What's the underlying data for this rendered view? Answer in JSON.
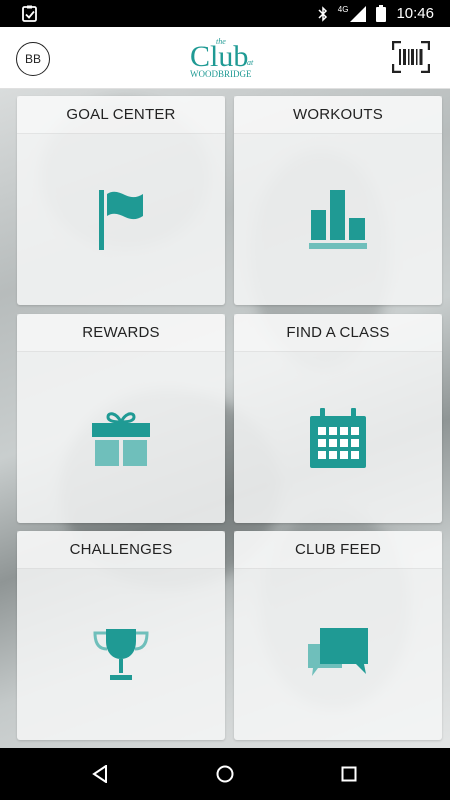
{
  "status_bar": {
    "time": "10:46",
    "network_type": "4G",
    "icons": [
      "checkbox-notification-icon",
      "bluetooth-icon",
      "signal-icon",
      "battery-icon"
    ]
  },
  "header": {
    "avatar_initials": "BB",
    "logo": {
      "line1": "the",
      "line2": "Club",
      "line3": "at",
      "line4": "WOODBRIDGE"
    },
    "barcode_icon": "barcode-scan-icon"
  },
  "tiles": [
    {
      "label": "GOAL CENTER",
      "icon": "flag-icon"
    },
    {
      "label": "WORKOUTS",
      "icon": "bar-chart-icon"
    },
    {
      "label": "REWARDS",
      "icon": "gift-icon"
    },
    {
      "label": "FIND A CLASS",
      "icon": "calendar-icon"
    },
    {
      "label": "CHALLENGES",
      "icon": "trophy-icon"
    },
    {
      "label": "CLUB FEED",
      "icon": "chat-bubbles-icon"
    }
  ],
  "nav": {
    "icons": [
      "back-icon",
      "home-icon",
      "recents-icon"
    ]
  },
  "colors": {
    "accent": "#1f9a94",
    "accent_light": "#6fbfbb",
    "status_bar": "#000000",
    "header_bg": "#ffffff"
  }
}
